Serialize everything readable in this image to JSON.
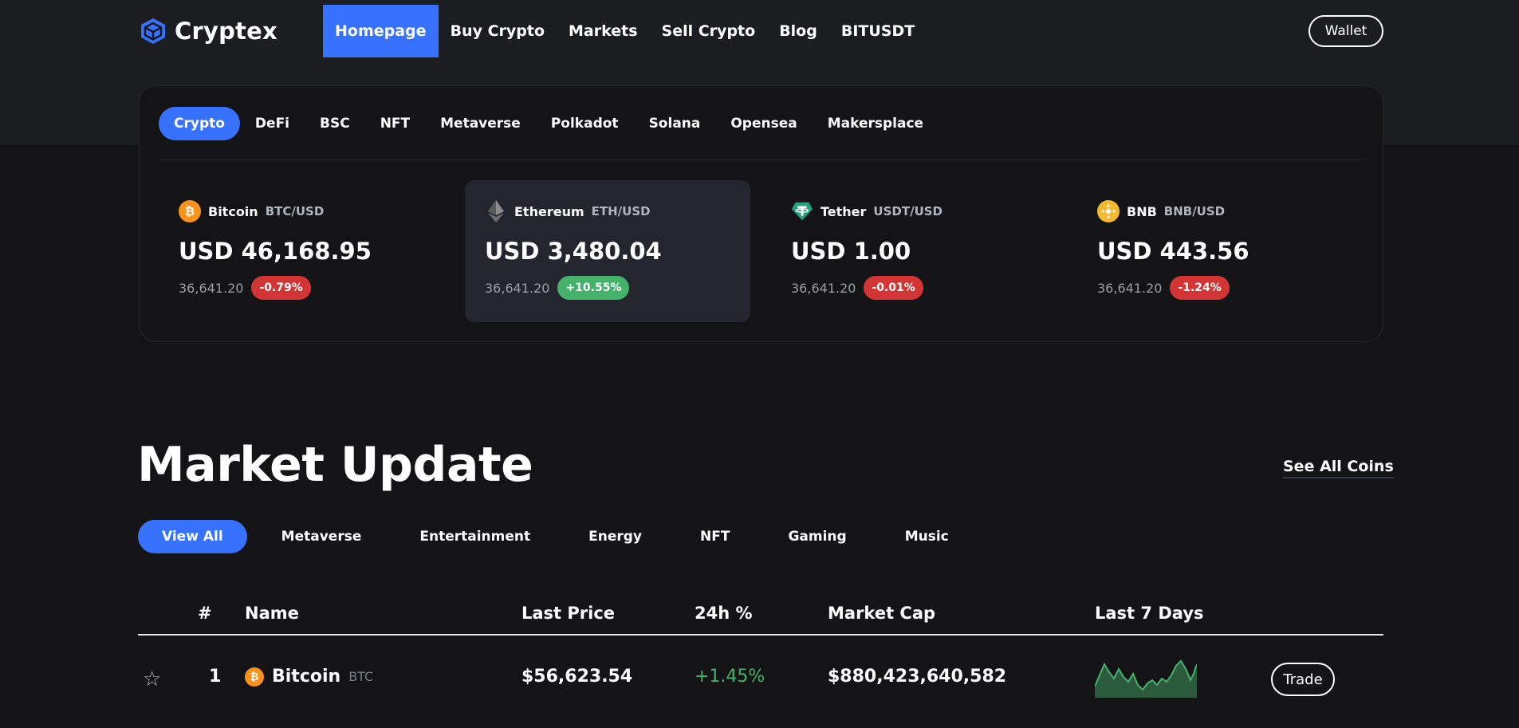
{
  "app": {
    "logo_text": "Cryptex",
    "logo_icon": "cube-icon"
  },
  "nav": {
    "items": [
      "Homepage",
      "Buy Crypto",
      "Markets",
      "Sell Crypto",
      "Blog",
      "BITUSDT"
    ],
    "active": "Homepage",
    "wallet_label": "Wallet"
  },
  "ticker": {
    "tabs": [
      "Crypto",
      "DeFi",
      "BSC",
      "NFT",
      "Metaverse",
      "Polkadot",
      "Solana",
      "Opensea",
      "Makersplace"
    ],
    "active_tab": "Crypto",
    "coins": [
      {
        "name": "Bitcoin",
        "pair": "BTC/USD",
        "price": "USD 46,168.95",
        "sub": "36,641.20",
        "change": "-0.79%",
        "trend": "down",
        "icon": "bitcoin-icon",
        "color": "#f7931a"
      },
      {
        "name": "Ethereum",
        "pair": "ETH/USD",
        "price": "USD 3,480.04",
        "sub": "36,641.20",
        "change": "+10.55%",
        "trend": "up",
        "icon": "ethereum-icon",
        "color": "#8c8c8c"
      },
      {
        "name": "Tether",
        "pair": "USDT/USD",
        "price": "USD 1.00",
        "sub": "36,641.20",
        "change": "-0.01%",
        "trend": "down",
        "icon": "tether-icon",
        "color": "#26a17b"
      },
      {
        "name": "BNB",
        "pair": "BNB/USD",
        "price": "USD 443.56",
        "sub": "36,641.20",
        "change": "-1.24%",
        "trend": "down",
        "icon": "bnb-icon",
        "color": "#f3ba2f"
      }
    ]
  },
  "market": {
    "title": "Market Update",
    "see_all": "See All Coins",
    "filters": [
      "View All",
      "Metaverse",
      "Entertainment",
      "Energy",
      "NFT",
      "Gaming",
      "Music"
    ],
    "active_filter": "View All",
    "columns": [
      "#",
      "Name",
      "Last Price",
      "24h %",
      "Market Cap",
      "Last 7 Days"
    ],
    "rows": [
      {
        "rank": "1",
        "name": "Bitcoin",
        "symbol": "BTC",
        "price": "$56,623.54",
        "change": "+1.45%",
        "market_cap": "$880,423,640,582",
        "action": "Trade",
        "icon": "bitcoin-icon",
        "star_icon": "star-outline-icon"
      }
    ]
  },
  "colors": {
    "accent": "#3772ff",
    "positive": "#45b26b",
    "negative": "#d33535",
    "background": "#141416"
  }
}
